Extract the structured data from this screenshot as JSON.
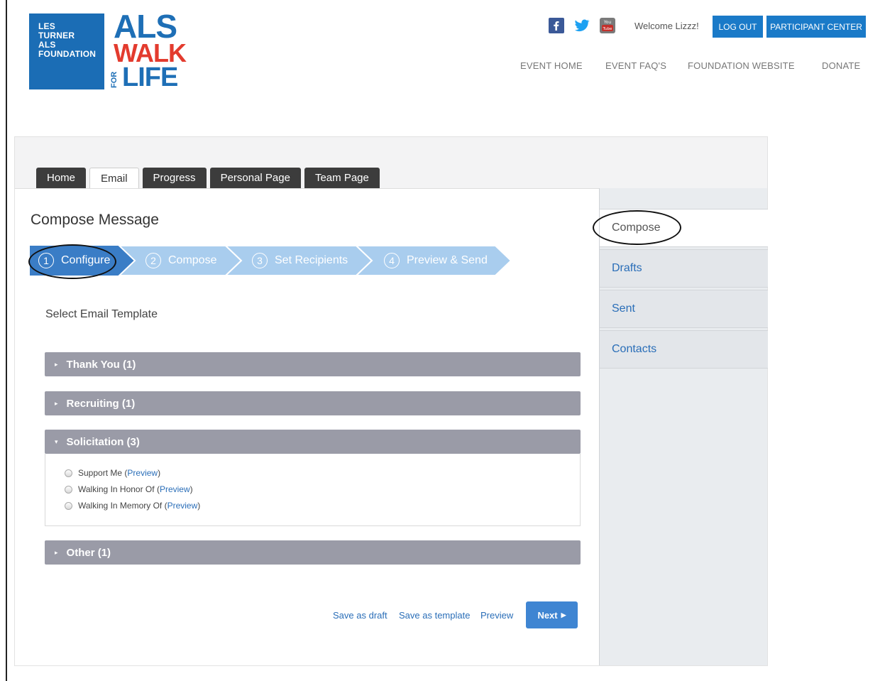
{
  "header": {
    "brand_lines": [
      "LES",
      "TURNER",
      "ALS",
      "FOUNDATION"
    ],
    "logo_title_1": "ALS",
    "logo_title_2": "WALK",
    "logo_title_for": "FOR",
    "logo_title_3": "LIFE",
    "social_icons": [
      "facebook-icon",
      "twitter-icon",
      "youtube-icon"
    ],
    "welcome": "Welcome Lizzz!",
    "logout_label": "LOG OUT",
    "participant_center_label": "PARTICIPANT CENTER",
    "nav": [
      "EVENT HOME",
      "EVENT FAQ'S",
      "FOUNDATION WEBSITE",
      "DONATE"
    ]
  },
  "tabs": [
    {
      "label": "Home",
      "active": false
    },
    {
      "label": "Email",
      "active": true
    },
    {
      "label": "Progress",
      "active": false
    },
    {
      "label": "Personal Page",
      "active": false
    },
    {
      "label": "Team Page",
      "active": false
    }
  ],
  "main": {
    "title": "Compose Message",
    "steps": [
      {
        "num": "1",
        "label": "Configure",
        "active": true
      },
      {
        "num": "2",
        "label": "Compose",
        "active": false
      },
      {
        "num": "3",
        "label": "Set Recipients",
        "active": false
      },
      {
        "num": "4",
        "label": "Preview & Send",
        "active": false
      }
    ],
    "select_label": "Select Email Template",
    "categories": [
      {
        "label": "Thank You (1)",
        "expanded": false
      },
      {
        "label": "Recruiting (1)",
        "expanded": false
      },
      {
        "label": "Solicitation (3)",
        "expanded": true
      },
      {
        "label": "Other (1)",
        "expanded": false
      }
    ],
    "templates": [
      {
        "name": "Support Me",
        "preview": "Preview"
      },
      {
        "name": "Walking In Honor Of",
        "preview": "Preview"
      },
      {
        "name": "Walking In Memory Of",
        "preview": "Preview"
      }
    ],
    "footer": {
      "save_draft": "Save as draft",
      "save_template": "Save as template",
      "preview": "Preview",
      "next": "Next"
    }
  },
  "sidebar": {
    "items": [
      {
        "label": "Compose",
        "active": true
      },
      {
        "label": "Drafts",
        "active": false
      },
      {
        "label": "Sent",
        "active": false
      },
      {
        "label": "Contacts",
        "active": false
      }
    ]
  },
  "colors": {
    "brand_blue": "#1b6db5",
    "brand_red": "#e33b2e",
    "step_active": "#3a7dc6",
    "step_inactive": "#a9cdee",
    "accordion": "#9a9ba7",
    "link": "#2a6eb8"
  }
}
